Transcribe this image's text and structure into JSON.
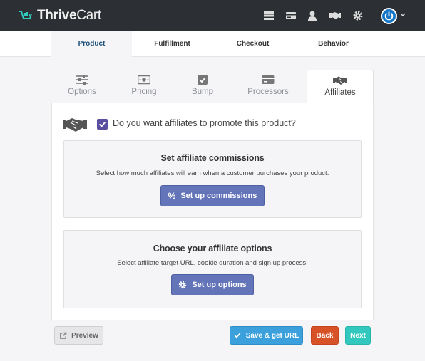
{
  "app": {
    "logo_text_bold": "Thrive",
    "logo_text_rest": "Cart",
    "colors": {
      "topbar": "#2c2f33",
      "accent_teal": "#33c8bd",
      "primary": "#6374b8"
    }
  },
  "topbar": {
    "icons": [
      "grid-icon",
      "credit-card-icon",
      "user-icon",
      "handshake-icon",
      "gear-icon",
      "power-icon",
      "chevron-down-icon"
    ]
  },
  "main_tabs": [
    {
      "label": "Product",
      "active": true
    },
    {
      "label": "Fulfillment",
      "active": false
    },
    {
      "label": "Checkout",
      "active": false
    },
    {
      "label": "Behavior",
      "active": false
    }
  ],
  "sub_tabs": [
    {
      "label": "Options",
      "icon": "sliders-icon",
      "active": false
    },
    {
      "label": "Pricing",
      "icon": "money-icon",
      "active": false
    },
    {
      "label": "Bump",
      "icon": "check-square-icon",
      "active": false
    },
    {
      "label": "Processors",
      "icon": "credit-card-icon",
      "active": false
    },
    {
      "label": "Affiliates",
      "icon": "handshake-icon",
      "active": true
    }
  ],
  "affiliates": {
    "promote_question": "Do you want affiliates to promote this product?",
    "promote_checked": true,
    "commissions": {
      "title": "Set affiliate commissions",
      "description": "Select how much affiliates will earn when a customer purchases your product.",
      "button_label": "Set up commissions",
      "button_icon": "percent-icon"
    },
    "options": {
      "title": "Choose your affiliate options",
      "description": "Select affiliate target URL, cookie duration and sign up process.",
      "button_label": "Set up options",
      "button_icon": "gear-icon"
    }
  },
  "footer": {
    "preview_label": "Preview",
    "save_label": "Save & get URL",
    "back_label": "Back",
    "next_label": "Next"
  }
}
